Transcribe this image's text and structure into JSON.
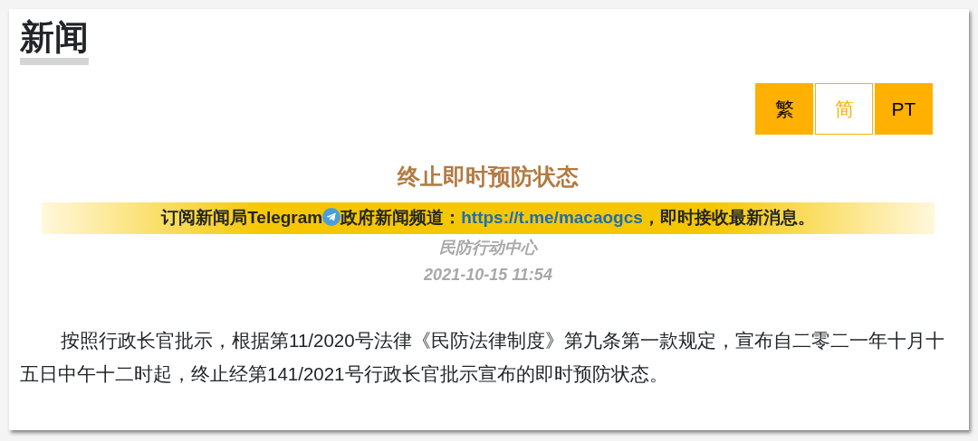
{
  "section_title": "新闻",
  "languages": [
    {
      "label": "繁",
      "selected": false
    },
    {
      "label": "简",
      "selected": true
    },
    {
      "label": "PT",
      "selected": false
    }
  ],
  "headline": "终止即时预防状态",
  "subscribe": {
    "before_icon": "订阅新闻局Telegram",
    "after_icon": "政府新闻频道：",
    "link": "https://t.me/macaogcs",
    "after_link": "，即时接收最新消息。"
  },
  "source": "民防行动中心",
  "date": "2021-10-15 11:54",
  "body": "按照行政长官批示，根据第11/2020号法律《民防法律制度》第九条第一款规定，宣布自二零二一年十月十五日中午十二时起，终止经第141/2021号行政长官批示宣布的即时预防状态。"
}
